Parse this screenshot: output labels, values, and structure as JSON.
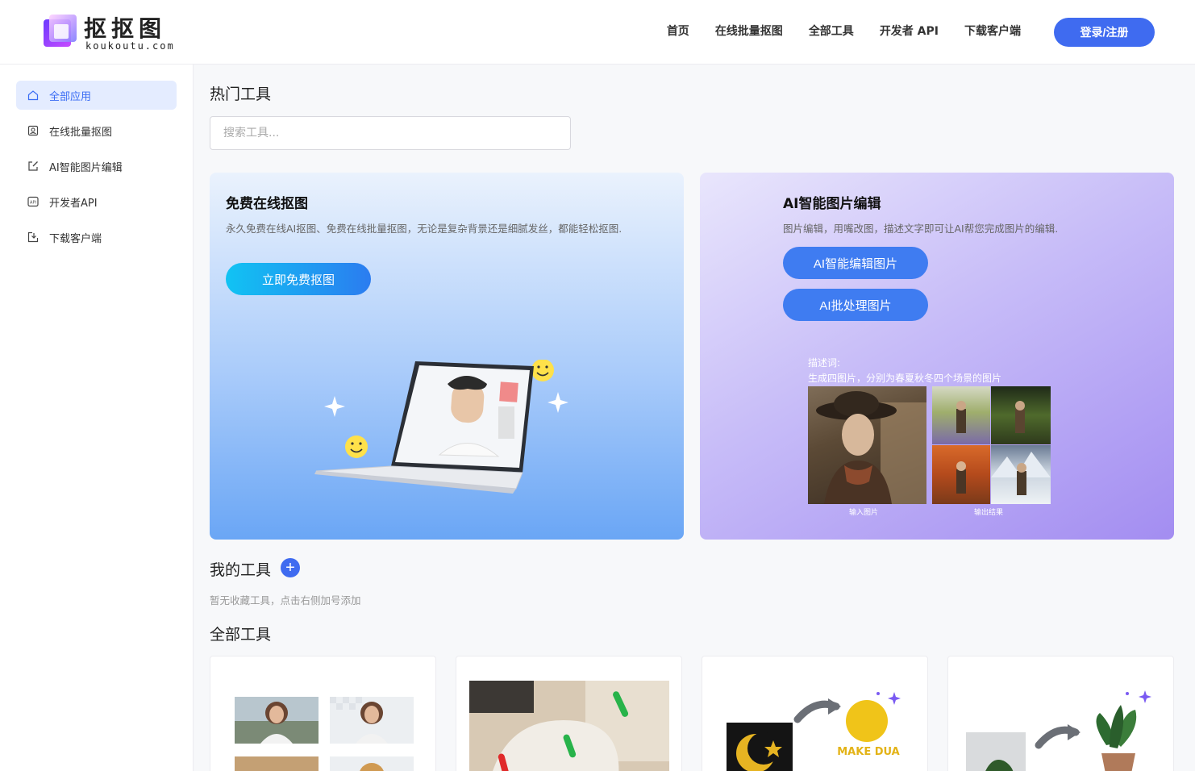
{
  "header": {
    "logo_title": "抠抠图",
    "logo_sub": "koukoutu.com",
    "nav": [
      "首页",
      "在线批量抠图",
      "全部工具",
      "开发者 API",
      "下载客户端"
    ],
    "login_label": "登录/注册"
  },
  "sidebar": {
    "items": [
      {
        "label": "全部应用",
        "icon": "home-icon",
        "active": true
      },
      {
        "label": "在线批量抠图",
        "icon": "portrait-icon",
        "active": false
      },
      {
        "label": "AI智能图片编辑",
        "icon": "edit-icon",
        "active": false
      },
      {
        "label": "开发者API",
        "icon": "api-icon",
        "active": false
      },
      {
        "label": "下载客户端",
        "icon": "download-icon",
        "active": false
      }
    ]
  },
  "main": {
    "hot_title": "热门工具",
    "search_placeholder": "搜索工具...",
    "cards": {
      "left": {
        "title": "免费在线抠图",
        "desc": "永久免费在线AI抠图、免费在线批量抠图，无论是复杂背景还是细腻发丝，都能轻松抠图.",
        "button": "立即免费抠图"
      },
      "right": {
        "title": "AI智能图片编辑",
        "desc": "图片编辑，用嘴改图，描述文字即可让AI帮您完成图片的编辑.",
        "button1": "AI智能编辑图片",
        "button2": "AI批处理图片",
        "prompt_label": "描述词:",
        "prompt_text": "生成四图片，分别为春夏秋冬四个场景的图片",
        "caption_input": "输入图片",
        "caption_output": "输出结果"
      }
    },
    "my_tools_title": "我的工具",
    "my_tools_empty": "暂无收藏工具，点击右侧加号添加",
    "all_tools_title": "全部工具"
  },
  "colors": {
    "accent": "#3f6bf0",
    "active_bg": "#e4ecff"
  }
}
